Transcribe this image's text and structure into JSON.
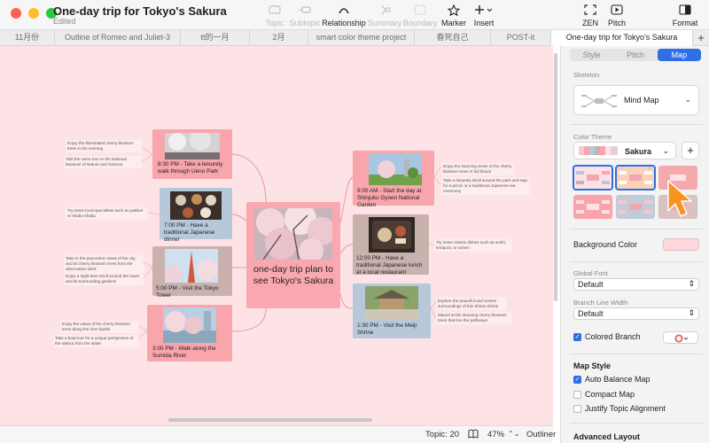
{
  "window": {
    "title": "One-day trip for Tokyo's Sakura",
    "subtitle": "Edited"
  },
  "toolbar": {
    "topic": "Topic",
    "subtopic": "Subtopic",
    "relationship": "Relationship",
    "summary": "Summary",
    "boundary": "Boundary",
    "marker": "Marker",
    "insert": "Insert",
    "zen": "ZEN",
    "pitch": "Pitch",
    "format": "Format"
  },
  "tabs": [
    "11月份",
    "Outline of Romeo and Juliet-3",
    "tt的一月",
    "2月",
    "smart color theme project",
    "春死自己",
    "POST-it",
    "One-day trip for Tokyo's Sakura"
  ],
  "map": {
    "central": "one-day trip plan to see Tokyo's Sakura",
    "topics": [
      "8:30 PM - Take a leisurely walk through Ueno Park",
      "7:00 PM - Have a traditional Japanese dinner",
      "5:00 PM - Visit the Tokyo Tower",
      "3:00 PM - Walk along the Sumida River",
      "9:00 AM - Start the day at Shinjuku Gyoen National Garden",
      "12:00 PM - Have a traditional Japanese lunch at a local restaurant",
      "1:30 PM - Visit the Meiji Shrine"
    ],
    "notes": [
      "Enjoy the illuminated cherry blossom trees in the evening",
      "Visit the Ueno Zoo or the National Museum of Nature and Science",
      "Try some local specialties such as yakitori or shabu-shabu",
      "Take in the panoramic views of the city and its cherry blossom trees from the observation deck",
      "Enjoy a night-time stroll around the tower and its surrounding gardens",
      "Enjoy the views of the cherry blossom trees along the river banks",
      "Take a boat tour for a unique perspective of the sakura from the water",
      "Enjoy the stunning views of the cherry blossom trees in full bloom",
      "Take a leisurely stroll around the park and stop for a picnic or a traditional Japanese tea ceremony",
      "Try some classic dishes such as sushi, tempura, or ramen",
      "Explore the peaceful and serene surroundings of this Shinto shrine",
      "Marvel at the stunning cherry blossom trees that line the pathways"
    ]
  },
  "status": {
    "topics": "Topic: 20",
    "zoom": "47%",
    "outliner": "Outliner"
  },
  "panel": {
    "tabs": [
      "Style",
      "Pitch",
      "Map"
    ],
    "skeleton_label": "Skeleton",
    "skeleton_value": "Mind Map",
    "color_theme_label": "Color Theme",
    "color_theme_value": "Sakura",
    "background_color_label": "Background Color",
    "global_font_label": "Global Font",
    "global_font_value": "Default",
    "branch_width_label": "Branch Line Width",
    "branch_width_value": "Default",
    "colored_branch_label": "Colored Branch",
    "map_style_label": "Map Style",
    "auto_balance_label": "Auto Balance Map",
    "compact_label": "Compact Map",
    "justify_label": "Justify Topic Alignment",
    "advanced_label": "Advanced Layout"
  },
  "colors": {
    "canvas": "#fee3e6",
    "central": "#f9a8af",
    "accent": "#2f6fe4",
    "cursor": "#f7931e"
  }
}
